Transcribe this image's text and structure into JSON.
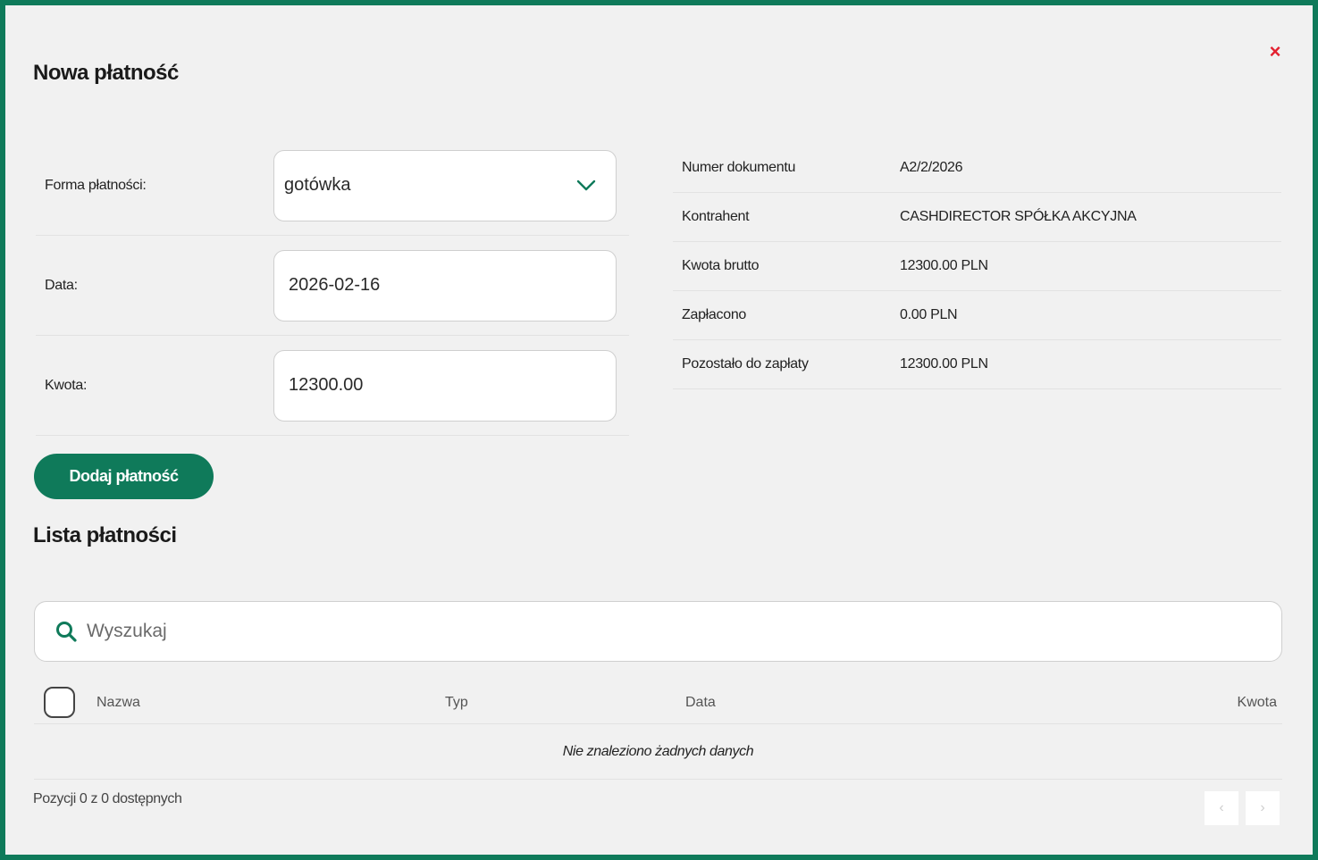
{
  "modal": {
    "title": "Nowa płatność",
    "close_label": "×"
  },
  "form": {
    "payment_method_label": "Forma płatności:",
    "payment_method_value": "gotówka",
    "date_label": "Data:",
    "date_value": "2026-02-16",
    "amount_label": "Kwota:",
    "amount_value": "12300.00"
  },
  "info": [
    {
      "key": "Numer dokumentu",
      "value": "A2/2/2026"
    },
    {
      "key": "Kontrahent",
      "value": "CASHDIRECTOR SPÓŁKA AKCYJNA"
    },
    {
      "key": "Kwota brutto",
      "value": "12300.00 PLN"
    },
    {
      "key": "Zapłacono",
      "value": "0.00 PLN"
    },
    {
      "key": "Pozostało do zapłaty",
      "value": "12300.00 PLN"
    }
  ],
  "add_button_label": "Dodaj płatność",
  "list": {
    "title": "Lista płatności",
    "search_placeholder": "Wyszukaj",
    "columns": {
      "name": "Nazwa",
      "type": "Typ",
      "date": "Data",
      "amount": "Kwota"
    },
    "empty_message": "Nie znaleziono żadnych danych",
    "footer_text": "Pozycji 0 z 0 dostępnych",
    "prev_label": "‹",
    "next_label": "›"
  },
  "colors": {
    "accent": "#0f7a5a",
    "close": "#e3202f",
    "background": "#f1f1f1"
  }
}
